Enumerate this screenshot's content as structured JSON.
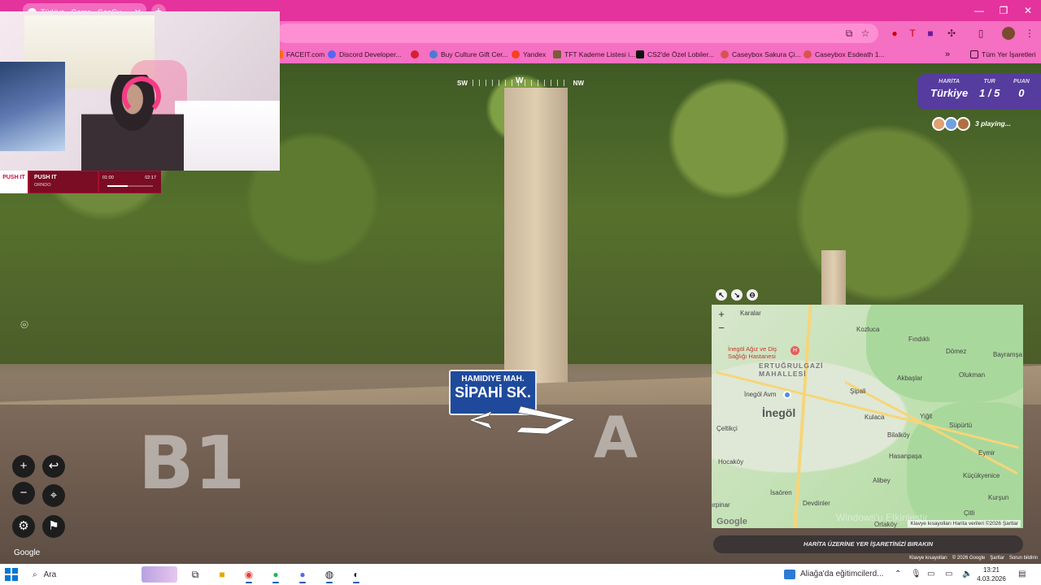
{
  "browser": {
    "tab_title": "Türkiye - Game - GeoGuessr",
    "tab_close": "✕",
    "new_tab": "+",
    "window_controls": [
      "—",
      "❐",
      "✕"
    ]
  },
  "bookmarks": {
    "items": [
      {
        "label": "FACEIT.com",
        "color": "#ff6a13"
      },
      {
        "label": "Discord Developer...",
        "color": "#5865f2"
      },
      {
        "label": "",
        "color": "#d6202f"
      },
      {
        "label": "Buy Culture Gift Cer...",
        "color": "#4a7bd4"
      },
      {
        "label": "Yandex",
        "color": "#fc3f1d"
      },
      {
        "label": "TFT Kademe Listesi i...",
        "color": "#7b5b3a"
      },
      {
        "label": "CS2'de Özel Lobiler...",
        "color": "#111111"
      },
      {
        "label": "Caseybox Sakura Çi...",
        "color": "#d9534f"
      },
      {
        "label": "Caseybox Esdeath 1...",
        "color": "#d9534f"
      }
    ],
    "more": "»",
    "all_bookmarks": "Tüm Yer İşaretleri"
  },
  "music": {
    "logo": "PUSH IT",
    "song": "PUSH IT",
    "artist": "ORNDO",
    "elapsed": "01:00",
    "total": "02:17",
    "progress": 0.44
  },
  "compass": {
    "left": "SW",
    "center": "W",
    "right": "NW"
  },
  "hud": {
    "map_label": "HARİTA",
    "map_value": "Türkiye",
    "round_label": "TUR",
    "round_value": "1 / 5",
    "score_label": "PUAN",
    "score_value": "0",
    "players": "3 playing..."
  },
  "street_sign": {
    "line1": "HAMIDIYE MAH.",
    "line2": "SİPAHİ SK."
  },
  "tools": {
    "zoom_in": "+",
    "zoom_out": "−",
    "undo": "↩",
    "checkpoint": "⌖",
    "settings": "⚙",
    "flag": "⚑",
    "google": "Google"
  },
  "map": {
    "zoom_in": "+",
    "zoom_out": "−",
    "labels": {
      "karalar": "Karalar",
      "kozluca": "Kozluca",
      "findikli": "Fındıklı",
      "domez": "Dömez",
      "bayramsa": "Bayramşa",
      "hospital": "İnegöl Ağız ve Diş Sağlığı Hastanesi",
      "ertugrulgazi": "ERTUĞRULGAZİ MAHALLESİ",
      "akbaslar": "Akbaşlar",
      "olukman": "Olukman",
      "inegol_avm": "İnegöl Avm",
      "sipali": "Şipali",
      "inegol": "İnegöl",
      "kulaca": "Kulaca",
      "yigit": "Yiğit",
      "suparturu": "Süpürtü",
      "celtikci": "Çeltikçi",
      "bilalkoy": "Bilalköy",
      "hasanpasa": "Hasanpaşa",
      "eymir": "Eymir",
      "hocakoy": "Hocaköy",
      "kucukyenice": "Küçükyenice",
      "alibey": "Alibey",
      "kursunlu": "Kurşun",
      "isaoren": "İsaören",
      "devedere": "Devdinler",
      "ciftlik": "Çitli",
      "ortakoy": "Ortaköy",
      "parinar": "ırpinar"
    },
    "google": "Google",
    "attribution": "Klavye kısayolları   Harita verileri ©2026   Şartlar"
  },
  "guess_button": "HARİTA ÜZERİNE YER İŞARETİNİZİ BIRAKIN",
  "sv_footer": [
    "Klavye kısayolları",
    "© 2026 Google",
    "Şartlar",
    "Sorun bildirin"
  ],
  "watermark": "Windows'u Etkinleştir",
  "taskbar": {
    "search": "Ara",
    "weather": "Aliağa'da eğitimcilerd...",
    "time": "13:21",
    "date": "4.03.2026"
  }
}
